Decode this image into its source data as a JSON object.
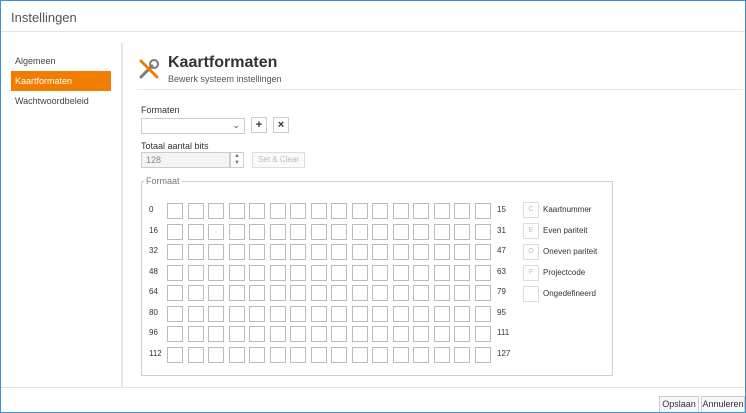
{
  "window": {
    "title": "Instellingen"
  },
  "sidebar": {
    "items": [
      {
        "label": "Algemeen",
        "active": false
      },
      {
        "label": "Kaartformaten",
        "active": true
      },
      {
        "label": "Wachtwoordbeleid",
        "active": false
      }
    ]
  },
  "header": {
    "icon": "tools-icon",
    "title": "Kaartformaten",
    "subtitle": "Bewerk systeem instellingen"
  },
  "form": {
    "formaten_label": "Formaten",
    "formaten_value": "",
    "add_icon": "plus-icon",
    "delete_icon": "close-icon",
    "bits_label": "Totaal aantal bits",
    "bits_value": "128",
    "set_clear_label": "Set & Clear"
  },
  "format": {
    "legend": "Formaat",
    "rows": [
      {
        "start": "0",
        "end": "15"
      },
      {
        "start": "16",
        "end": "31"
      },
      {
        "start": "32",
        "end": "47"
      },
      {
        "start": "48",
        "end": "63"
      },
      {
        "start": "64",
        "end": "79"
      },
      {
        "start": "80",
        "end": "95"
      },
      {
        "start": "96",
        "end": "111"
      },
      {
        "start": "112",
        "end": "127"
      }
    ],
    "bit_types": [
      {
        "code": "C",
        "label": "Kaartnummer"
      },
      {
        "code": "E",
        "label": "Even pariteit"
      },
      {
        "code": "O",
        "label": "Oneven pariteit"
      },
      {
        "code": "F",
        "label": "Projectcode"
      },
      {
        "code": "",
        "label": "Ongedefineerd"
      }
    ]
  },
  "footer": {
    "save_label": "Opslaan",
    "cancel_label": "Annuleren"
  },
  "colors": {
    "accent": "#f07d00",
    "window_border": "#3d8fd6"
  }
}
